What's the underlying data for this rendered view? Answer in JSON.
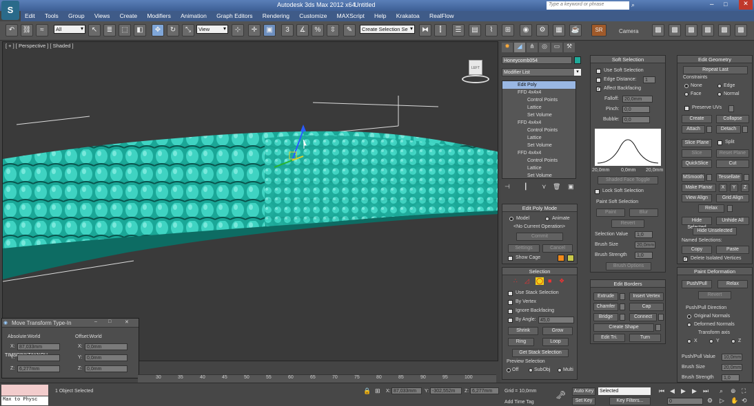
{
  "title": {
    "app": "Autodesk 3ds Max  2012 x64",
    "doc": "Untitled",
    "search_placeholder": "Type a keyword or phrase"
  },
  "menu": [
    "Edit",
    "Tools",
    "Group",
    "Views",
    "Create",
    "Modifiers",
    "Animation",
    "Graph Editors",
    "Rendering",
    "Customize",
    "MAXScript",
    "Help",
    "Krakatoa",
    "RealFlow"
  ],
  "toolbar": {
    "selection_filter": "All",
    "ref_coord": "View",
    "named_selection": "Create Selection Se",
    "camera_label": "Camera",
    "sr_label": "SR"
  },
  "viewport": {
    "label": "[ + ] [ Perspective ] [ Shaded ]",
    "cube_label": "LEFT"
  },
  "ruler_ticks": [
    "30",
    "35",
    "40",
    "45",
    "50",
    "55",
    "60",
    "65",
    "70",
    "75",
    "80",
    "85",
    "90",
    "95",
    "100"
  ],
  "command_tabs": [
    "create-icon",
    "modify-icon",
    "hierarchy-icon",
    "motion-icon",
    "display-icon",
    "utilities-icon"
  ],
  "object_name": "Honeycomb054",
  "object_color": "#1faa9a",
  "modifier_list": "Modifier List",
  "stack": [
    {
      "label": "Edit Poly",
      "indent": 0,
      "selected": true
    },
    {
      "label": "FFD 4x4x4",
      "indent": 0
    },
    {
      "label": "Control Points",
      "indent": 1
    },
    {
      "label": "Lattice",
      "indent": 1
    },
    {
      "label": "Set Volume",
      "indent": 1
    },
    {
      "label": "FFD 4x4x4",
      "indent": 0
    },
    {
      "label": "Control Points",
      "indent": 1
    },
    {
      "label": "Lattice",
      "indent": 1
    },
    {
      "label": "Set Volume",
      "indent": 1
    },
    {
      "label": "FFD 4x4x4",
      "indent": 0
    },
    {
      "label": "Control Points",
      "indent": 1
    },
    {
      "label": "Lattice",
      "indent": 1
    },
    {
      "label": "Set Volume",
      "indent": 1
    }
  ],
  "edit_poly_mode": {
    "title": "Edit Poly Mode",
    "model": "Model",
    "animate": "Animate",
    "current_op": "<No Current Operation>",
    "commit": "Commit",
    "settings": "Settings",
    "cancel": "Cancel",
    "show_cage": "Show Cage"
  },
  "selection": {
    "title": "Selection",
    "use_stack": "Use Stack Selection",
    "by_vertex": "By Vertex",
    "ignore_backfacing": "Ignore Backfacing",
    "by_angle": "By Angle:",
    "angle": "45,0",
    "shrink": "Shrink",
    "grow": "Grow",
    "ring": "Ring",
    "loop": "Loop",
    "get_stack": "Get Stack Selection",
    "preview": "Preview Selection",
    "off": "Off",
    "subobj": "SubObj",
    "multi": "Multi"
  },
  "soft_selection": {
    "title": "Soft Selection",
    "use_soft": "Use Soft Selection",
    "edge_distance": "Edge Distance:",
    "edge_value": "1",
    "affect_backfacing": "Affect Backfacing",
    "falloff": "Falloff:",
    "falloff_value": "20,0mm",
    "pinch": "Pinch:",
    "pinch_value": "0,0",
    "bubble": "Bubble:",
    "bubble_value": "0,0",
    "curve_labels": [
      "20,0mm",
      "0,0mm",
      "20,0mm"
    ],
    "shaded_face": "Shaded Face Toggle",
    "lock_soft": "Lock Soft Selection",
    "paint_title": "Paint Soft Selection",
    "paint": "Paint",
    "blur": "Blur",
    "revert": "Revert",
    "sel_value": "Selection Value",
    "sel_value_v": "1,0",
    "brush_size": "Brush Size",
    "brush_size_v": "20,0mm",
    "brush_strength": "Brush Strength",
    "brush_strength_v": "1,0",
    "brush_options": "Brush Options"
  },
  "edit_borders": {
    "title": "Edit Borders",
    "extrude": "Extrude",
    "insert_vertex": "Insert Vertex",
    "chamfer": "Chamfer",
    "cap": "Cap",
    "bridge": "Bridge",
    "connect": "Connect",
    "create_shape": "Create Shape",
    "edit_tri": "Edit Tri.",
    "turn": "Turn"
  },
  "edit_geometry": {
    "title": "Edit Geometry",
    "repeat_last": "Repeat Last",
    "constraints": "Constraints",
    "none": "None",
    "edge": "Edge",
    "face": "Face",
    "normal": "Normal",
    "preserve_uvs": "Preserve UVs",
    "create": "Create",
    "collapse": "Collapse",
    "attach": "Attach",
    "detach": "Detach",
    "slice_plane": "Slice Plane",
    "split": "Split",
    "slice": "Slice",
    "reset_plane": "Reset Plane",
    "quickslice": "QuickSlice",
    "cut": "Cut",
    "msmooth": "MSmooth",
    "tessellate": "Tessellate",
    "make_planar": "Make Planar",
    "x": "X",
    "y": "Y",
    "z": "Z",
    "view_align": "View Align",
    "grid_align": "Grid Align",
    "relax": "Relax",
    "hide_selected": "Hide Selected",
    "unhide_all": "Unhide All",
    "hide_unselected": "Hide Unselected",
    "named_sel": "Named Selections:",
    "copy": "Copy",
    "paste": "Paste",
    "delete_isolated": "Delete Isolated Vertices"
  },
  "paint_deformation": {
    "title": "Paint Deformation",
    "push_pull": "Push/Pull",
    "relax": "Relax",
    "revert": "Revert",
    "direction": "Push/Pull Direction",
    "original_normals": "Original Normals",
    "deformed_normals": "Deformed Normals",
    "transform_axis": "Transform axis",
    "x": "X",
    "y": "Y",
    "z": "Z",
    "pp_value": "Push/Pull Value",
    "pp_value_v": "10,0mm",
    "brush_size": "Brush Size",
    "brush_size_v": "20,0mm",
    "brush_strength": "Brush Strength",
    "brush_strength_v": "1,0"
  },
  "move_dialog": {
    "title": "Move Transform Type-In",
    "absolute": "Absolute:World",
    "offset": "Offset:World",
    "abs_x": "87,033mm",
    "abs_y": "",
    "abs_z": "6,277mm",
    "off_x": "0,0mm",
    "off_y": "0,0mm",
    "off_z": "0,0mm",
    "overlay": "TIMSRINKTAKNOU"
  },
  "status": {
    "selected": "1 Object Selected",
    "script": "Max to Physc",
    "x": "87,033mm",
    "y": "-302,552m",
    "z": "6,277mm",
    "grid": "Grid = 10,0mm",
    "add_time_tag": "Add Time Tag",
    "auto_key": "Auto Key",
    "set_key": "Set Key",
    "key_mode": "Selected",
    "key_filters": "Key Filters...",
    "frame": "0"
  }
}
